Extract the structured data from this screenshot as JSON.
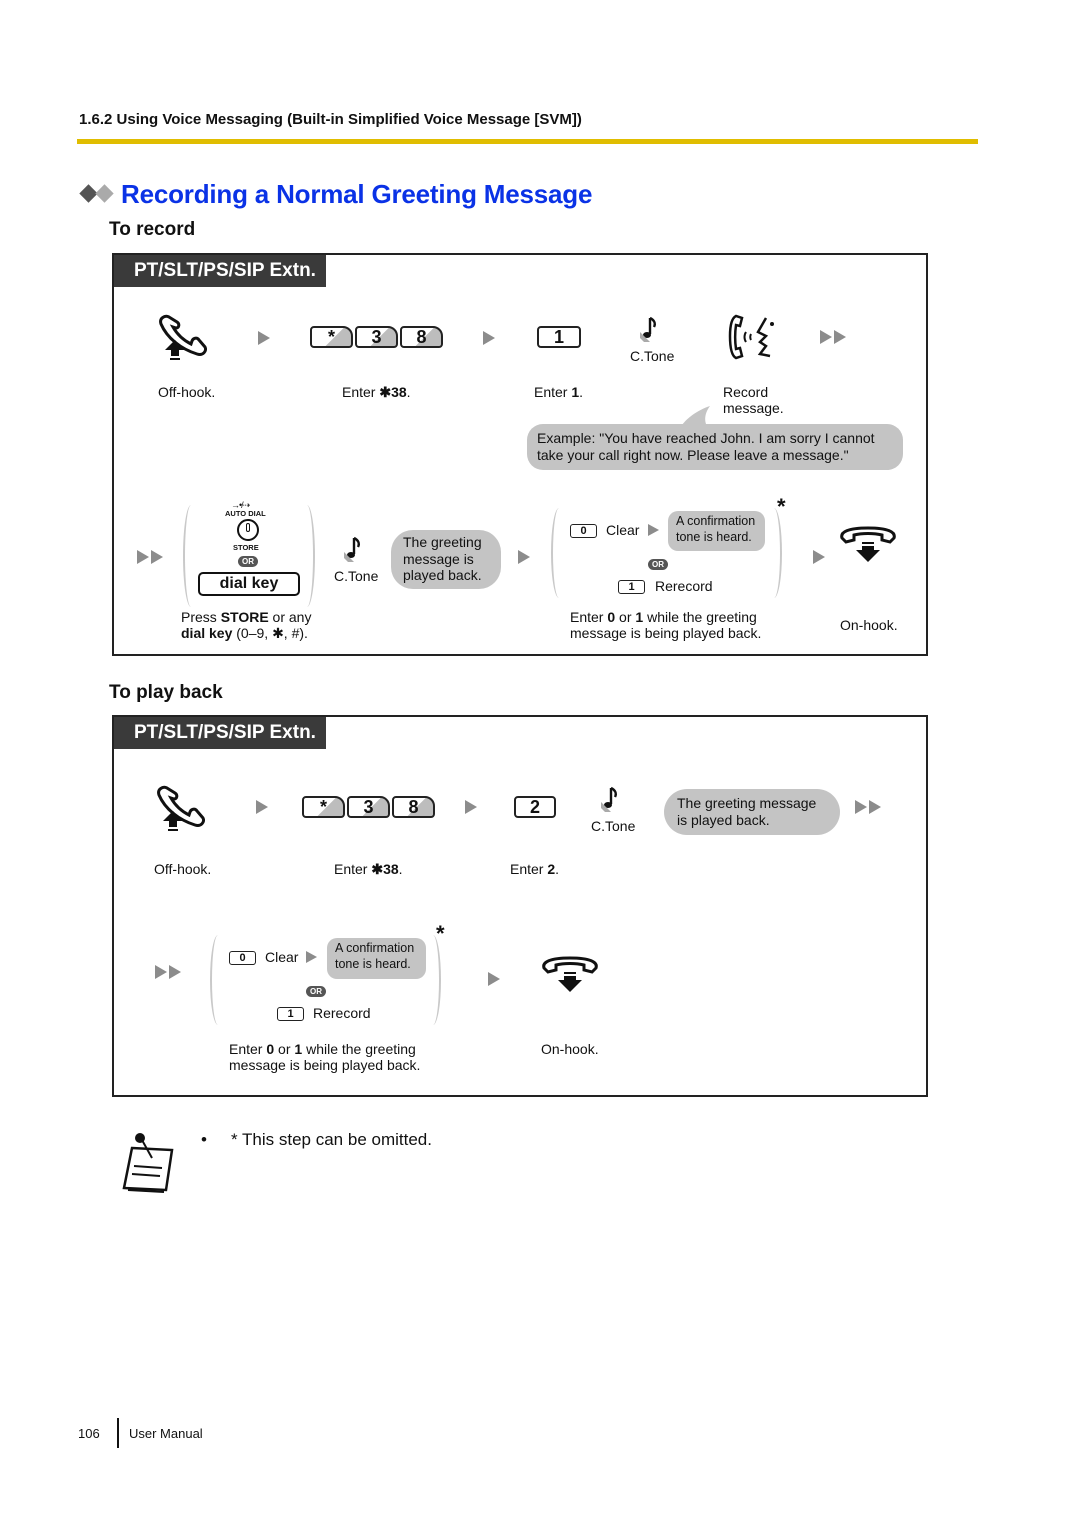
{
  "header": {
    "section": "1.6.2 Using Voice Messaging (Built-in Simplified Voice Message [SVM])",
    "rule_color": "#e0bd00"
  },
  "title": {
    "text": "Recording a Normal Greeting Message",
    "color": "#0a32e6",
    "icon": "double-diamond-icon"
  },
  "record": {
    "subhead": "To record",
    "panel_label": "PT/SLT/PS/SIP Extn.",
    "row1": {
      "offhook_caption": "Off-hook.",
      "keys": [
        "*",
        "3",
        "8"
      ],
      "enter_prefix": "Enter ",
      "enter_code": "✱38",
      "enter_suffix": ".",
      "key1": "1",
      "enter1_prefix": "Enter ",
      "enter1_code": "1",
      "enter1_suffix": ".",
      "ctone": "C.Tone",
      "record_caption_1": "Record",
      "record_caption_2": "message.",
      "example": "Example: \"You have reached John. I am sorry I cannot take your call right now. Please leave a message.\""
    },
    "row2": {
      "auto_dial": "AUTO DIAL",
      "store": "STORE",
      "or": "OR",
      "dial_key": "dial key",
      "press_1": "Press ",
      "press_store": "STORE",
      "press_2": " or any",
      "press_dialkey": "dial key",
      "press_3": " (0–9, ✱, #).",
      "ctone": "C.Tone",
      "greeting_bubble": "The greeting message is played back.",
      "key0": "0",
      "clear": "Clear",
      "confirm_bubble": "A confirmation tone is heard.",
      "key1": "1",
      "rerecord": "Rerecord",
      "asterisk": "*",
      "enter01_a": "Enter ",
      "enter01_b": "0",
      "enter01_c": " or ",
      "enter01_d": "1",
      "enter01_e": " while the greeting message is being played back.",
      "onhook": "On-hook."
    }
  },
  "playback": {
    "subhead": "To play back",
    "panel_label": "PT/SLT/PS/SIP Extn.",
    "row1": {
      "offhook_caption": "Off-hook.",
      "keys": [
        "*",
        "3",
        "8"
      ],
      "enter_prefix": "Enter ",
      "enter_code": "✱38",
      "enter_suffix": ".",
      "key2": "2",
      "enter2_prefix": "Enter ",
      "enter2_code": "2",
      "enter2_suffix": ".",
      "ctone": "C.Tone",
      "greeting_bubble": "The greeting message is played back."
    },
    "row2": {
      "key0": "0",
      "clear": "Clear",
      "confirm_bubble": "A confirmation tone is heard.",
      "or": "OR",
      "key1": "1",
      "rerecord": "Rerecord",
      "asterisk": "*",
      "enter01_a": "Enter ",
      "enter01_b": "0",
      "enter01_c": " or ",
      "enter01_d": "1",
      "enter01_e": " while the greeting message is being played back.",
      "onhook": "On-hook."
    }
  },
  "note": {
    "bullet": "•",
    "text": "* This step can be omitted."
  },
  "footer": {
    "page_number": "106",
    "label": "User Manual"
  }
}
